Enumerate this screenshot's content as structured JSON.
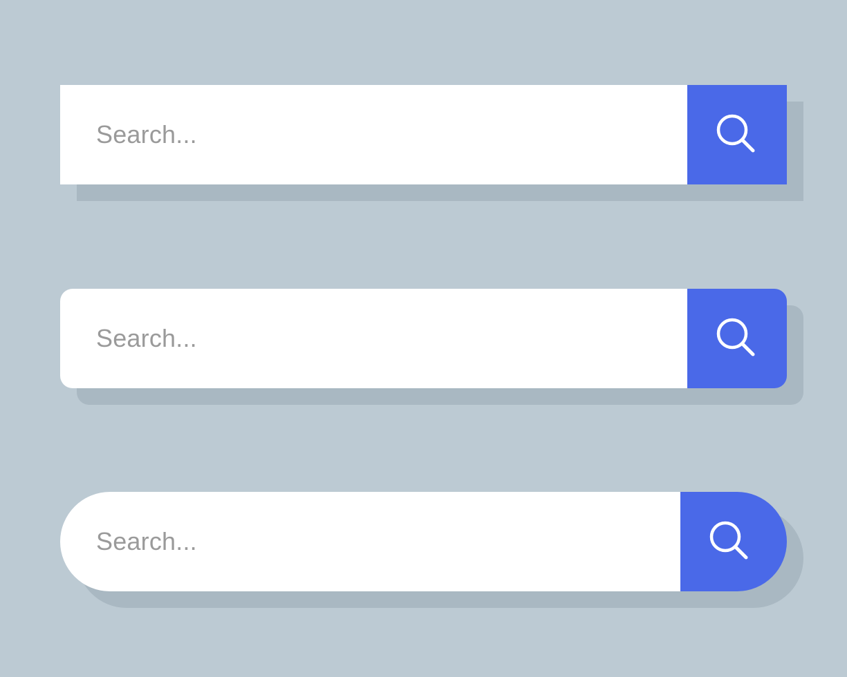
{
  "colors": {
    "background": "#bccad3",
    "field": "#ffffff",
    "button": "#4a69e8",
    "placeholder_text": "#9a9a9a",
    "icon": "#ffffff"
  },
  "search_bars": [
    {
      "style": "square",
      "placeholder": "Search...",
      "button_icon": "search-icon"
    },
    {
      "style": "rounded",
      "placeholder": "Search...",
      "button_icon": "search-icon"
    },
    {
      "style": "pill",
      "placeholder": "Search...",
      "button_icon": "search-icon"
    }
  ]
}
